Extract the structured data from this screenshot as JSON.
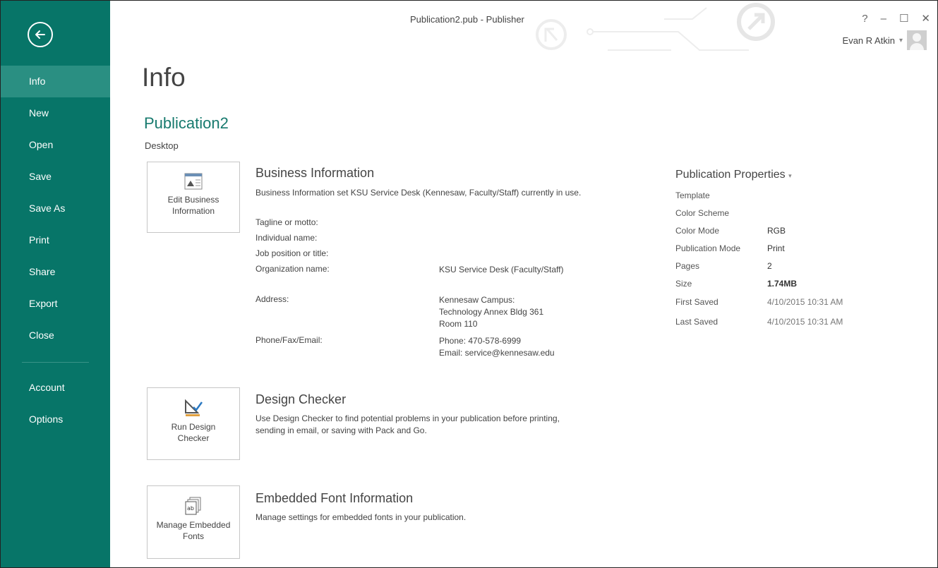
{
  "window": {
    "title": "Publication2.pub - Publisher",
    "help": "?",
    "minimize": "–",
    "maximize": "☐",
    "close": "✕",
    "user_name": "Evan R Atkin",
    "user_dropdown": "▾"
  },
  "sidebar": {
    "back_icon": "back-arrow-icon",
    "items": [
      {
        "label": "Info",
        "active": true
      },
      {
        "label": "New"
      },
      {
        "label": "Open"
      },
      {
        "label": "Save"
      },
      {
        "label": "Save As"
      },
      {
        "label": "Print"
      },
      {
        "label": "Share"
      },
      {
        "label": "Export"
      },
      {
        "label": "Close"
      }
    ],
    "bottom_items": [
      {
        "label": "Account"
      },
      {
        "label": "Options"
      }
    ],
    "bg_color": "#077568",
    "active_color": "#2a8f82"
  },
  "main": {
    "title": "Info",
    "doc_name": "Publication2",
    "doc_location": "Desktop",
    "business": {
      "button_label": "Edit Business Information",
      "heading": "Business Information",
      "description": "Business Information set KSU Service Desk (Kennesaw, Faculty/Staff) currently in use.",
      "rows": [
        {
          "label": "Tagline or motto:",
          "value": ""
        },
        {
          "label": "Individual name:",
          "value": ""
        },
        {
          "label": "Job position or title:",
          "value": ""
        },
        {
          "label": "Organization name:",
          "value": "KSU Service Desk (Faculty/Staff)"
        },
        {
          "label": "Address:",
          "value_lines": [
            "Kennesaw Campus:",
            "Technology Annex Bldg 361",
            "Room 110"
          ]
        },
        {
          "label": "Phone/Fax/Email:",
          "value_lines": [
            "Phone: 470-578-6999",
            "Email: service@kennesaw.edu"
          ]
        }
      ]
    },
    "design_checker": {
      "button_label": "Run Design Checker",
      "heading": "Design Checker",
      "description": "Use Design Checker to find potential problems in your publication before printing, sending in email, or saving with Pack and Go."
    },
    "fonts": {
      "button_label": "Manage Embedded Fonts",
      "heading": "Embedded Font Information",
      "description": "Manage settings for embedded fonts in your publication."
    }
  },
  "properties": {
    "title": "Publication Properties",
    "dropdown": "▾",
    "rows": [
      {
        "label": "Template",
        "value": ""
      },
      {
        "label": "Color Scheme",
        "value": ""
      },
      {
        "label": "Color Mode",
        "value": "RGB"
      },
      {
        "label": "Publication Mode",
        "value": "Print"
      },
      {
        "label": "Pages",
        "value": "2"
      },
      {
        "label": "Size",
        "value": "1.74MB"
      },
      {
        "label": "First Saved",
        "value": "4/10/2015 10:31 AM"
      },
      {
        "label": "Last Saved",
        "value": "4/10/2015 10:31 AM"
      }
    ]
  }
}
